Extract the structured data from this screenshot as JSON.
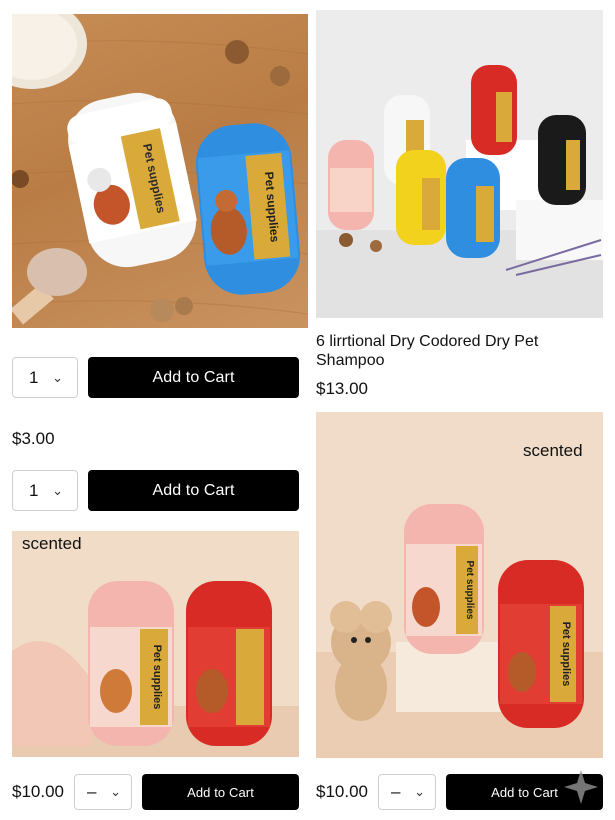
{
  "products": [
    {
      "image_alt": "white-and-blue-pet-supplies-jars",
      "jar_label": "Pet supplies",
      "quantity": "1",
      "add_to_cart": "Add to Cart"
    },
    {
      "image_alt": "six-colored-pet-supplies-jars",
      "jar_label": "Pet supplies",
      "title": "6 lirrtional Dry Codored Dry Pet Shampoo",
      "price": "$13.00"
    },
    {
      "price": "$3.00",
      "quantity": "1",
      "add_to_cart": "Add to Cart"
    },
    {
      "tag": "scented",
      "jar_label": "Pet supplies",
      "price": "$10.00",
      "quantity": "–",
      "add_to_cart": "Add to Cart"
    },
    {
      "tag": "scented",
      "jar_label": "Pet supplies",
      "price": "$10.00",
      "quantity": "–",
      "add_to_cart": "Add to Cart"
    }
  ],
  "icons": {
    "dropdown": "chevron-down-icon",
    "sparkle": "sparkle-icon"
  },
  "colors": {
    "button_bg": "#000000",
    "button_text": "#ffffff",
    "wood": "#c48a52",
    "grey_backdrop": "#ededed",
    "peach_backdrop": "#f1d9c4",
    "jar_red": "#d92b25",
    "jar_pink": "#f3b5ad",
    "jar_blue": "#2f8ee0",
    "jar_white": "#f7f7f7",
    "gold": "#d9a93a"
  }
}
